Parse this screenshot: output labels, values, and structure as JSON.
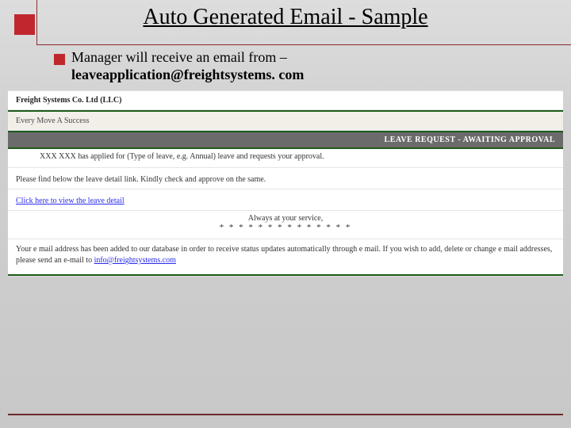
{
  "title": "Auto Generated Email - Sample",
  "intro": {
    "line1": "Manager will receive an email from –",
    "line2": "leaveapplication@freightsystems. com"
  },
  "email": {
    "company": "Freight Systems Co. Ltd (LLC)",
    "tagline": "Every Move A Success",
    "banner": "LEAVE REQUEST - AWAITING APPROVAL",
    "detail": "XXX XXX    has applied for (Type of leave, e.g. Annual) leave and requests your approval.",
    "instruction": "Please find below the leave detail link. Kindly check and approve on the same.",
    "link_text": "Click here to view the leave detail",
    "signoff": "Always at your service,",
    "stars": "* * * * * * * * * * * * * *",
    "footer_pre": "Your e mail address has been added to our database in order to receive status updates automatically through e mail. If you wish to add, delete or change e mail addresses, please send an e-mail to ",
    "footer_email": "info@freightsystems.com"
  }
}
